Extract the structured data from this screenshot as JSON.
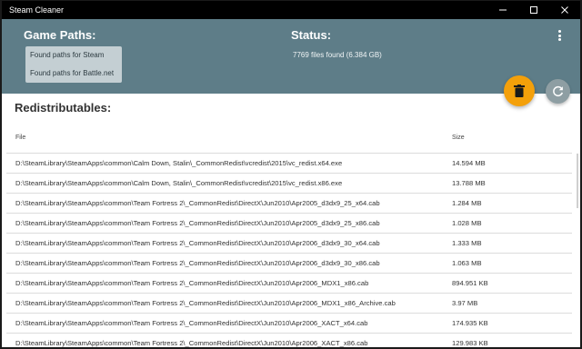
{
  "window": {
    "title": "Steam Cleaner"
  },
  "header": {
    "game_paths_title": "Game Paths:",
    "paths": [
      "Found paths for Steam",
      "Found paths for Battle.net"
    ],
    "status_title": "Status:",
    "status_text": "7769 files found (6.384 GB)"
  },
  "actions": {
    "delete_icon": "trash-icon",
    "refresh_icon": "refresh-icon"
  },
  "redistributables": {
    "title": "Redistributables:",
    "columns": {
      "file": "File",
      "size": "Size"
    },
    "rows": [
      {
        "file": "D:\\SteamLibrary\\SteamApps\\common\\Calm Down, Stalin\\_CommonRedist\\vcredist\\2015\\vc_redist.x64.exe",
        "size": "14.594 MB"
      },
      {
        "file": "D:\\SteamLibrary\\SteamApps\\common\\Calm Down, Stalin\\_CommonRedist\\vcredist\\2015\\vc_redist.x86.exe",
        "size": "13.788 MB"
      },
      {
        "file": "D:\\SteamLibrary\\SteamApps\\common\\Team Fortress 2\\_CommonRedist\\DirectX\\Jun2010\\Apr2005_d3dx9_25_x64.cab",
        "size": "1.284 MB"
      },
      {
        "file": "D:\\SteamLibrary\\SteamApps\\common\\Team Fortress 2\\_CommonRedist\\DirectX\\Jun2010\\Apr2005_d3dx9_25_x86.cab",
        "size": "1.028 MB"
      },
      {
        "file": "D:\\SteamLibrary\\SteamApps\\common\\Team Fortress 2\\_CommonRedist\\DirectX\\Jun2010\\Apr2006_d3dx9_30_x64.cab",
        "size": "1.333 MB"
      },
      {
        "file": "D:\\SteamLibrary\\SteamApps\\common\\Team Fortress 2\\_CommonRedist\\DirectX\\Jun2010\\Apr2006_d3dx9_30_x86.cab",
        "size": "1.063 MB"
      },
      {
        "file": "D:\\SteamLibrary\\SteamApps\\common\\Team Fortress 2\\_CommonRedist\\DirectX\\Jun2010\\Apr2006_MDX1_x86.cab",
        "size": "894.951 KB"
      },
      {
        "file": "D:\\SteamLibrary\\SteamApps\\common\\Team Fortress 2\\_CommonRedist\\DirectX\\Jun2010\\Apr2006_MDX1_x86_Archive.cab",
        "size": "3.97 MB"
      },
      {
        "file": "D:\\SteamLibrary\\SteamApps\\common\\Team Fortress 2\\_CommonRedist\\DirectX\\Jun2010\\Apr2006_XACT_x64.cab",
        "size": "174.935 KB"
      },
      {
        "file": "D:\\SteamLibrary\\SteamApps\\common\\Team Fortress 2\\_CommonRedist\\DirectX\\Jun2010\\Apr2006_XACT_x86.cab",
        "size": "129.983 KB"
      }
    ]
  },
  "colors": {
    "header_bg": "#5e7d88",
    "accent": "#f4a00a",
    "refresh_bg": "#8e9ea3"
  }
}
